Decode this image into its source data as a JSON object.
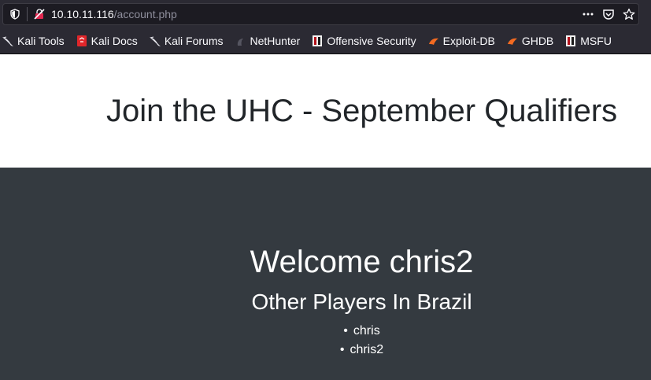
{
  "browser": {
    "url_host": "10.10.11.116",
    "url_path": "/account.php"
  },
  "bookmarks": [
    {
      "label": "Kali Tools",
      "icon": "kali-dragon-icon"
    },
    {
      "label": "Kali Docs",
      "icon": "kali-docs-icon"
    },
    {
      "label": "Kali Forums",
      "icon": "kali-dragon-icon"
    },
    {
      "label": "NetHunter",
      "icon": "nethunter-icon"
    },
    {
      "label": "Offensive Security",
      "icon": "offsec-icon"
    },
    {
      "label": "Exploit-DB",
      "icon": "exploitdb-icon"
    },
    {
      "label": "GHDB",
      "icon": "ghdb-icon"
    },
    {
      "label": "MSFU",
      "icon": "msfu-icon"
    }
  ],
  "header": {
    "title": "Join the UHC - September Qualifiers"
  },
  "main": {
    "welcome": "Welcome chris2",
    "subtitle": "Other Players In Brazil",
    "players": [
      "chris",
      "chris2"
    ]
  },
  "colors": {
    "header_bg": "#ffffff",
    "main_bg": "#343a40",
    "chrome_bg": "#2b2a33"
  }
}
